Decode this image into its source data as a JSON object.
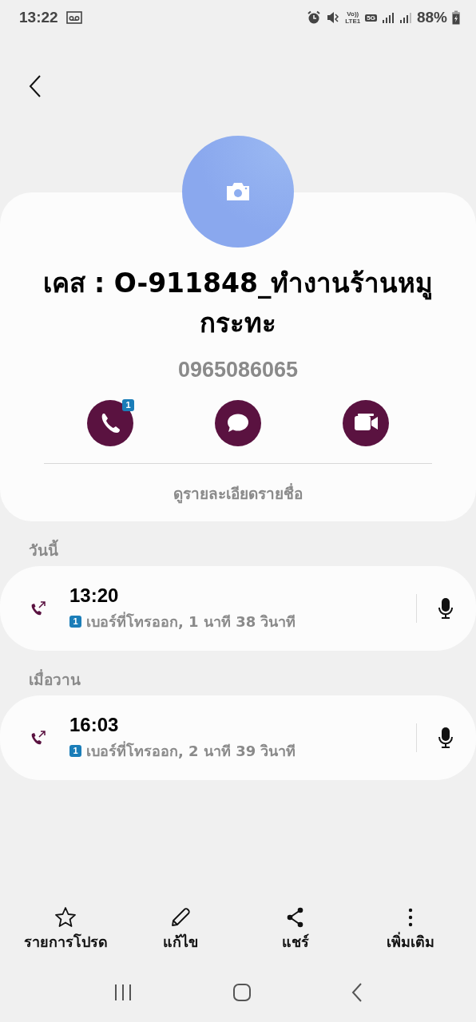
{
  "status_bar": {
    "time": "13:22",
    "volte": "Vo))",
    "network": "LTE1",
    "band": "5G",
    "battery": "88%"
  },
  "contact": {
    "name": "เคส : O-911848_ทำงานร้านหมูกระทะ",
    "phone": "0965086065",
    "call_badge": "1",
    "details_link": "ดูรายละเอียดรายชื่อ"
  },
  "history": [
    {
      "label": "วันนี้",
      "calls": [
        {
          "kind": "outgoing",
          "time": "13:20",
          "sim": "1",
          "description": "เบอร์ที่โทรออก, 1 นาที 38 วินาที"
        }
      ]
    },
    {
      "label": "เมื่อวาน",
      "calls": [
        {
          "kind": "outgoing",
          "time": "16:03",
          "sim": "1",
          "description": "เบอร์ที่โทรออก, 2 นาที 39 วินาที"
        }
      ]
    }
  ],
  "actions": [
    {
      "kind": "favorite",
      "label": "รายการโปรด"
    },
    {
      "kind": "edit",
      "label": "แก้ไข"
    },
    {
      "kind": "share",
      "label": "แชร์"
    },
    {
      "kind": "more",
      "label": "เพิ่มเติม"
    }
  ]
}
